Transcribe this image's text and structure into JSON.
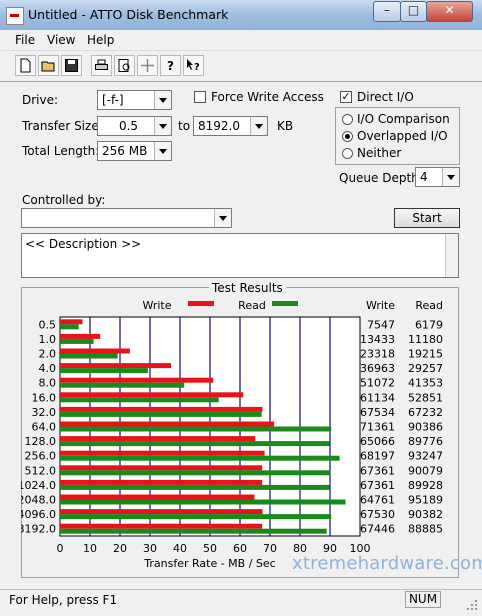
{
  "window": {
    "title": "Untitled - ATTO Disk Benchmark",
    "min_glyph": "–",
    "max_glyph": "□",
    "close_glyph": "✕"
  },
  "menu": [
    "File",
    "View",
    "Help"
  ],
  "toolbar": {
    "icons": [
      "new-icon",
      "open-icon",
      "save-icon",
      "print-icon",
      "print-preview-icon",
      "move-icon",
      "help-icon",
      "context-help-icon"
    ]
  },
  "form": {
    "drive_label": "Drive:",
    "drive_value": "[-f-]",
    "force_write_label": "Force Write Access",
    "direct_io_label": "Direct I/O",
    "direct_io_checked": true,
    "transfer_size_label": "Transfer Size:",
    "transfer_from": "0.5",
    "to_label": "to",
    "transfer_to": "8192.0",
    "kb_label": "KB",
    "total_length_label": "Total Length:",
    "total_length_value": "256 MB",
    "io_options": [
      "I/O Comparison",
      "Overlapped I/O",
      "Neither"
    ],
    "io_selected": "Overlapped I/O",
    "queue_depth_label": "Queue Depth:",
    "queue_depth_value": "4",
    "controlled_by_label": "Controlled by:",
    "controlled_by_value": "",
    "start_label": "Start",
    "description": "<< Description >>"
  },
  "results": {
    "title": "Test Results",
    "legend_write": "Write",
    "legend_read": "Read",
    "col_write": "Write",
    "col_read": "Read",
    "xlabel": "Transfer Rate - MB / Sec",
    "write_color": "#e8141b",
    "read_color": "#1a8a1a"
  },
  "chart_data": {
    "type": "bar",
    "orientation": "horizontal",
    "title": "Test Results",
    "xlabel": "Transfer Rate - MB / Sec",
    "xlim": [
      0,
      100
    ],
    "xticks": [
      0,
      10,
      20,
      30,
      40,
      50,
      60,
      70,
      80,
      90,
      100
    ],
    "categories": [
      "0.5",
      "1.0",
      "2.0",
      "4.0",
      "8.0",
      "16.0",
      "32.0",
      "64.0",
      "128.0",
      "256.0",
      "512.0",
      "1024.0",
      "2048.0",
      "4096.0",
      "8192.0"
    ],
    "series": [
      {
        "name": "Write",
        "values": [
          7.5,
          13.4,
          23.3,
          37.0,
          51.1,
          61.1,
          67.5,
          71.4,
          65.1,
          68.2,
          67.4,
          67.4,
          64.8,
          67.5,
          67.4
        ]
      },
      {
        "name": "Read",
        "values": [
          6.2,
          11.2,
          19.2,
          29.3,
          41.4,
          52.9,
          67.2,
          90.4,
          89.8,
          93.2,
          90.1,
          89.9,
          95.2,
          90.4,
          88.9
        ]
      }
    ],
    "write_kb": [
      "7547",
      "13433",
      "23318",
      "36963",
      "51072",
      "61134",
      "67534",
      "71361",
      "65066",
      "68197",
      "67361",
      "67361",
      "64761",
      "67530",
      "67446"
    ],
    "read_kb": [
      "6179",
      "11180",
      "19215",
      "29257",
      "41353",
      "52851",
      "67232",
      "90386",
      "89776",
      "93247",
      "90079",
      "89928",
      "95189",
      "90382",
      "88885"
    ],
    "grid": true
  },
  "status": {
    "text": "For Help, press F1",
    "num": "NUM"
  },
  "watermark": "xtremehardware.com"
}
